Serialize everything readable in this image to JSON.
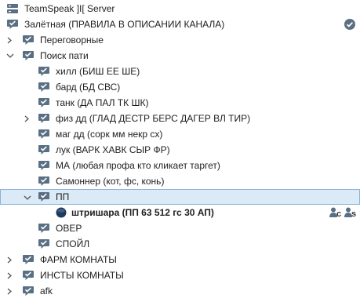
{
  "server": {
    "name": "TeamSpeak ]I[ Server"
  },
  "channels": {
    "zaletnaya": "Залётная (ПРАВИЛА В ОПИСАНИИ КАНАЛА)",
    "peregovornye": "Переговорные",
    "poisk_pati": "Поиск пати",
    "sub": {
      "hill": "хилл (БИШ ЕЕ ШЕ)",
      "bard": "бард (БД СВС)",
      "tank": "танк (ДА ПАЛ ТК ШК)",
      "fiz": "физ дд (ГЛАД ДЕСТР БЕРС ДАГЕР ВЛ ТИР)",
      "mag": "маг дд (сорк мм некр сх)",
      "luk": "лук (ВАРК ХАВК СЫР ФР)",
      "ma": "МА (любая профа кто кликает таргет)",
      "samonner": "Самоннер (кот, фс, конь)",
      "pp": "ПП",
      "over": "ОВЕР",
      "spoil": "СПОЙЛ"
    },
    "farm": "ФАРМ КОМНАТЫ",
    "insty": "ИНСТЫ КОМНАТЫ",
    "afk": "afk"
  },
  "client": {
    "name": "штришара (ПП 63 512 гс 30 АП)",
    "badge_c": "c",
    "badge_s": "s"
  },
  "colors": {
    "channel_icon": "#5b6f84",
    "selection_bg": "#dbeaf7",
    "selection_border": "#8ab3d9",
    "verified": "#5b6f84"
  }
}
